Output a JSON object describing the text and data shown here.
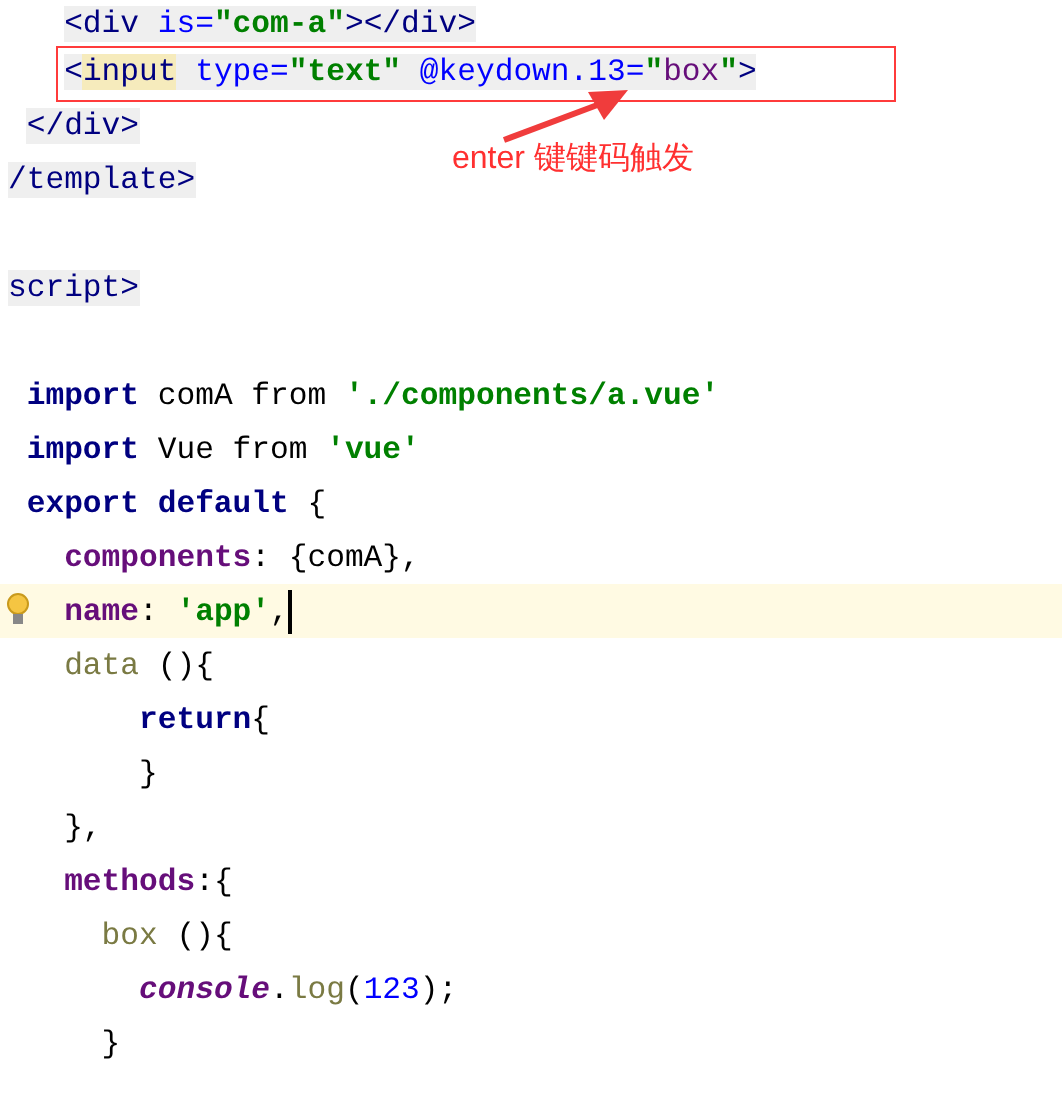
{
  "editor": {
    "lines": [
      {
        "current": false,
        "tokens": [
          {
            "kind": "tag",
            "text": "   <div"
          },
          {
            "kind": "attr",
            "text": " is="
          },
          {
            "kind": "attr-string",
            "text": "\"com-a\""
          },
          {
            "kind": "tag",
            "text": "></div>"
          }
        ]
      },
      {
        "current": false,
        "tokens": [
          {
            "kind": "tag",
            "text": "   <"
          },
          {
            "kind": "tag-match",
            "text": "input"
          },
          {
            "kind": "attr",
            "text": " type="
          },
          {
            "kind": "attr-string",
            "text": "\"text\""
          },
          {
            "kind": "attr",
            "text": " @keydown.13="
          },
          {
            "kind": "attr-string",
            "text": "\""
          },
          {
            "kind": "expr",
            "text": "box"
          },
          {
            "kind": "attr-string",
            "text": "\""
          },
          {
            "kind": "tag",
            "text": ">"
          }
        ]
      },
      {
        "current": false,
        "tokens": [
          {
            "kind": "tag",
            "text": " </div>"
          }
        ]
      },
      {
        "current": false,
        "tokens": [
          {
            "kind": "tag",
            "text": "/template>"
          }
        ]
      },
      {
        "current": false
      },
      {
        "current": false,
        "tokens": [
          {
            "kind": "tag",
            "text": "script>"
          }
        ]
      },
      {
        "current": false
      },
      {
        "current": false,
        "tokens": [
          {
            "kind": "keyword",
            "text": " import"
          },
          {
            "kind": "plain",
            "text": " comA from "
          },
          {
            "kind": "string",
            "text": "'./components/a.vue'"
          }
        ]
      },
      {
        "current": false,
        "tokens": [
          {
            "kind": "keyword",
            "text": " import"
          },
          {
            "kind": "plain",
            "text": " Vue from "
          },
          {
            "kind": "string",
            "text": "'vue'"
          }
        ]
      },
      {
        "current": false,
        "tokens": [
          {
            "kind": "keyword",
            "text": " export default"
          },
          {
            "kind": "plain",
            "text": " {"
          }
        ]
      },
      {
        "current": false,
        "tokens": [
          {
            "kind": "property",
            "text": "   components"
          },
          {
            "kind": "plain",
            "text": ": {comA},"
          }
        ]
      },
      {
        "current": true,
        "tokens": [
          {
            "kind": "property",
            "text": "   name"
          },
          {
            "kind": "plain",
            "text": ": "
          },
          {
            "kind": "string",
            "text": "'app'"
          },
          {
            "kind": "plain",
            "text": ","
          }
        ]
      },
      {
        "current": false,
        "tokens": [
          {
            "kind": "function",
            "text": "   data"
          },
          {
            "kind": "plain",
            "text": " (){"
          }
        ]
      },
      {
        "current": false,
        "tokens": [
          {
            "kind": "keyword",
            "text": "       return"
          },
          {
            "kind": "plain",
            "text": "{"
          }
        ]
      },
      {
        "current": false,
        "tokens": [
          {
            "kind": "plain",
            "text": "       }"
          }
        ]
      },
      {
        "current": false,
        "tokens": [
          {
            "kind": "plain",
            "text": "   },"
          }
        ]
      },
      {
        "current": false,
        "tokens": [
          {
            "kind": "property",
            "text": "   methods"
          },
          {
            "kind": "plain",
            "text": ":{"
          }
        ]
      },
      {
        "current": false,
        "tokens": [
          {
            "kind": "function",
            "text": "     box"
          },
          {
            "kind": "plain",
            "text": " (){"
          }
        ]
      },
      {
        "current": false,
        "tokens": [
          {
            "kind": "global",
            "text": "       console"
          },
          {
            "kind": "plain",
            "text": "."
          },
          {
            "kind": "function",
            "text": "log"
          },
          {
            "kind": "plain",
            "text": "("
          },
          {
            "kind": "number",
            "text": "123"
          },
          {
            "kind": "plain",
            "text": ");"
          }
        ]
      },
      {
        "current": false,
        "tokens": [
          {
            "kind": "plain",
            "text": "     }"
          }
        ]
      }
    ]
  },
  "annotation": {
    "label": "enter 键键码触发"
  }
}
